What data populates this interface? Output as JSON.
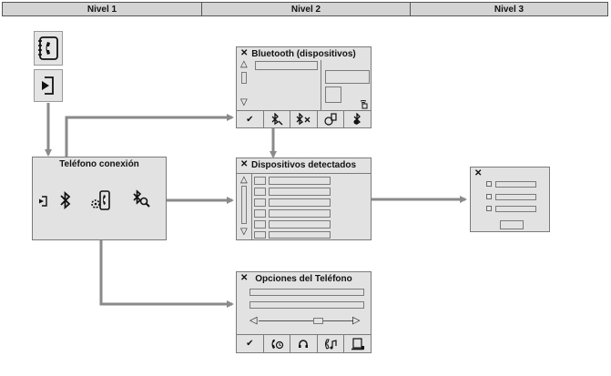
{
  "levels": [
    "Nivel 1",
    "Nivel 2",
    "Nivel 3"
  ],
  "phone_connection": {
    "title": "Teléfono conexión"
  },
  "bluetooth": {
    "title": "Bluetooth (dispositivos)",
    "close": "✕"
  },
  "detected": {
    "title": "Dispositivos detectados",
    "close": "✕"
  },
  "options": {
    "title": "Opciones del Teléfono",
    "close": "✕"
  },
  "level3": {
    "close": "✕"
  },
  "toolbar_glyphs": {
    "check": "✔"
  },
  "colors": {
    "panel": "#e2e2e2",
    "wire": "#8a8a8a",
    "header": "#d4d4d4"
  },
  "icons": [
    "phonebook-icon",
    "enter-icon",
    "bluetooth-icon",
    "phone-settings-icon",
    "bluetooth-search-icon",
    "checkmark-icon",
    "bluetooth-delete-icon",
    "bluetooth-off-icon",
    "bluetooth-connect-icon",
    "phone-clock-icon",
    "headset-icon",
    "phone-music-icon",
    "phone-transfer-icon"
  ]
}
